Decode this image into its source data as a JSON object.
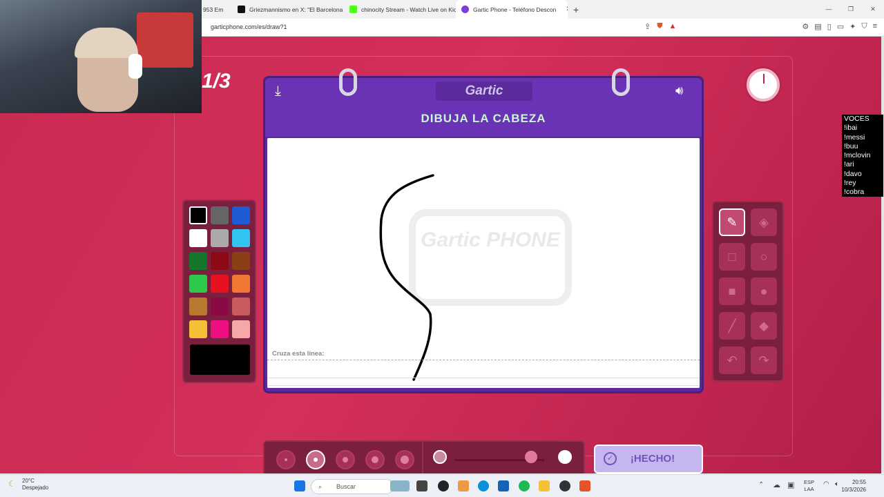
{
  "browser": {
    "tabs": [
      {
        "title": "953 Em",
        "color": "#e44"
      },
      {
        "title": "Griezmannismo en X: \"El Barcelona n",
        "color": "#111"
      },
      {
        "title": "chinocity Stream - Watch Live on Kick",
        "color": "#53fc18"
      },
      {
        "title": "Gartic Phone - Teléfono Descon",
        "color": "#7b3fd6"
      }
    ],
    "new_tab": "+",
    "close": "✕",
    "url": "garticphone.com/es/draw?1"
  },
  "game": {
    "round": "1/3",
    "logo": "Gartic",
    "prompt": "DIBUJA LA CABEZA",
    "cross_line_label": "Cruza esta línea:",
    "watermark": "Gartic PHONE",
    "done_label": "¡HECHO!",
    "palette": [
      "#000000",
      "#666666",
      "#1e5cd6",
      "#ffffff",
      "#aaaaaa",
      "#33c3f0",
      "#15762b",
      "#8b0a14",
      "#8b3f16",
      "#2ec84a",
      "#e8111f",
      "#f07830",
      "#b87830",
      "#8b0a46",
      "#c95a5e",
      "#f6c036",
      "#ee1080",
      "#f6a8a8"
    ],
    "current_color": "#000000",
    "brush_sizes": [
      1,
      2,
      3,
      4,
      5
    ],
    "selected_size_index": 1,
    "opacity_fraction": 0.85
  },
  "chat": {
    "lines": [
      "VOCES",
      "!ibai",
      "!messi",
      "!buu",
      "!mclovin",
      "!ari",
      "!davo",
      "!rey",
      "!cobra"
    ]
  },
  "taskbar": {
    "temp": "20°C",
    "weather": "Despejado",
    "search_placeholder": "Buscar",
    "lang1": "ESP",
    "lang2": "LAA",
    "time": "20:55",
    "date": "10/3/2026"
  }
}
